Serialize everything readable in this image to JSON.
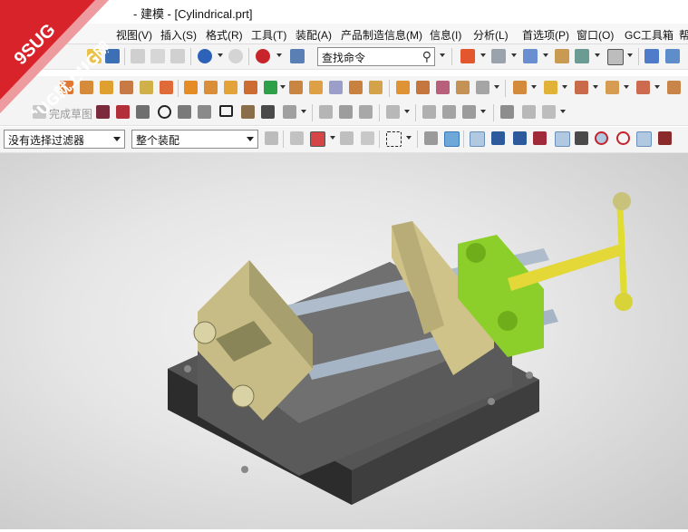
{
  "window": {
    "title": "- 建模 - [Cylindrical.prt]"
  },
  "watermark": {
    "line1": "9SUG",
    "line2": "学UG就上UG网"
  },
  "menu": {
    "items": [
      "视图(V)",
      "插入(S)",
      "格式(R)",
      "工具(T)",
      "装配(A)",
      "产品制造信息(M)",
      "信息(I)",
      "分析(L)",
      "首选项(P)",
      "窗口(O)",
      "GC工具箱",
      "帮"
    ]
  },
  "toolbar": {
    "search_value": "查找命令",
    "finish_sketch_label": "完成草图",
    "selection_filter": "没有选择过滤器",
    "assembly_scope": "整个装配"
  },
  "colors": {
    "accent_red": "#d8232a",
    "viewport_bg": "#e6e6e6",
    "jaw_tan": "#cfc38a",
    "handle_yellow": "#e7e43a",
    "clamp_green": "#8ccf2a",
    "base_dark": "#4a4a4a",
    "rod_blue": "#a8b8c8"
  }
}
